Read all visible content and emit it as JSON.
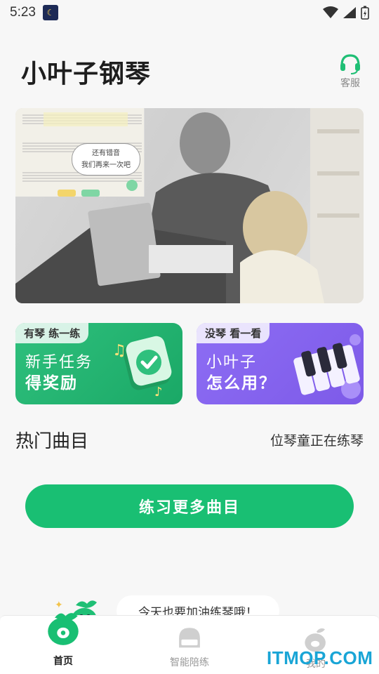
{
  "status_bar": {
    "time": "5:23"
  },
  "header": {
    "title": "小叶子钢琴",
    "service_label": "客服"
  },
  "banner": {
    "bubble_line1": "还有错音",
    "bubble_line2": "我们再来一次吧"
  },
  "cards": [
    {
      "tag": "有琴 练一练",
      "line1": "新手任务",
      "line2": "得奖励"
    },
    {
      "tag": "没琴 看一看",
      "line1": "小叶子",
      "line2": "怎么用？"
    }
  ],
  "section": {
    "title": "热门曲目",
    "subtitle": "位琴童正在练琴"
  },
  "more_button": {
    "label": "练习更多曲目"
  },
  "cheer": {
    "text": "今天也要加油练琴哦！"
  },
  "tabbar": {
    "items": [
      {
        "label": "首页"
      },
      {
        "label": "智能陪练"
      },
      {
        "label": "我的"
      }
    ]
  },
  "watermark": {
    "text": "ITMOP.COM"
  },
  "colors": {
    "brand_green": "#19bf73",
    "purple": "#7d5ae8",
    "watermark_blue": "#19a5d6"
  }
}
